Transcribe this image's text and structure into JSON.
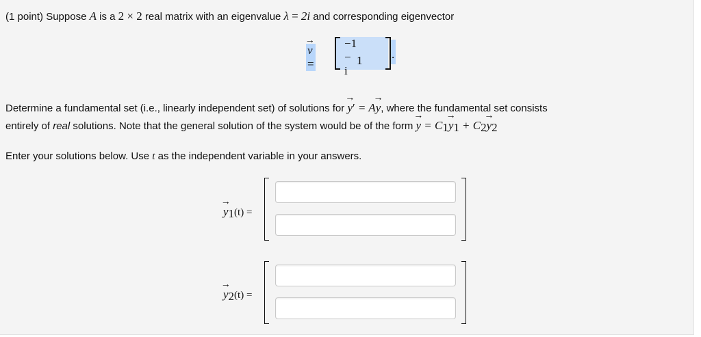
{
  "problem": {
    "points": "(1 point)",
    "intro_text": "Suppose",
    "intro_matrix": "A",
    "intro_mid": "is a",
    "intro_dims": "2 × 2",
    "intro_rest": "real matrix with an eigenvalue",
    "lambda": "λ",
    "eq": "=",
    "eigenvalue": "2i",
    "intro_tail": "and corresponding eigenvector"
  },
  "eigenvector": {
    "symbol": "v",
    "equals": "=",
    "entries": [
      "−1 − i",
      "1"
    ],
    "period": "."
  },
  "instructions": {
    "line1_a": "Determine a fundamental set (i.e., linearly independent set) of solutions for",
    "line1_y": "y",
    "line1_prime": "′",
    "line1_eq": "= A",
    "line1_y2": "y",
    "line1_b": ", where the fundamental set consists",
    "line2_a": "entirely of",
    "line2_em": "real",
    "line2_b": "solutions. Note that the general solution of the system would be of the form",
    "line2_formula": "= C",
    "line3_a": "Enter your solutions below. Use",
    "line3_t": "t",
    "line3_b": "as the independent variable in your answers."
  },
  "answers": [
    {
      "label_sub": "1",
      "label_arg": "(t) =",
      "inputs": [
        "",
        ""
      ]
    },
    {
      "label_sub": "2",
      "label_arg": "(t) =",
      "inputs": [
        "",
        ""
      ]
    }
  ]
}
